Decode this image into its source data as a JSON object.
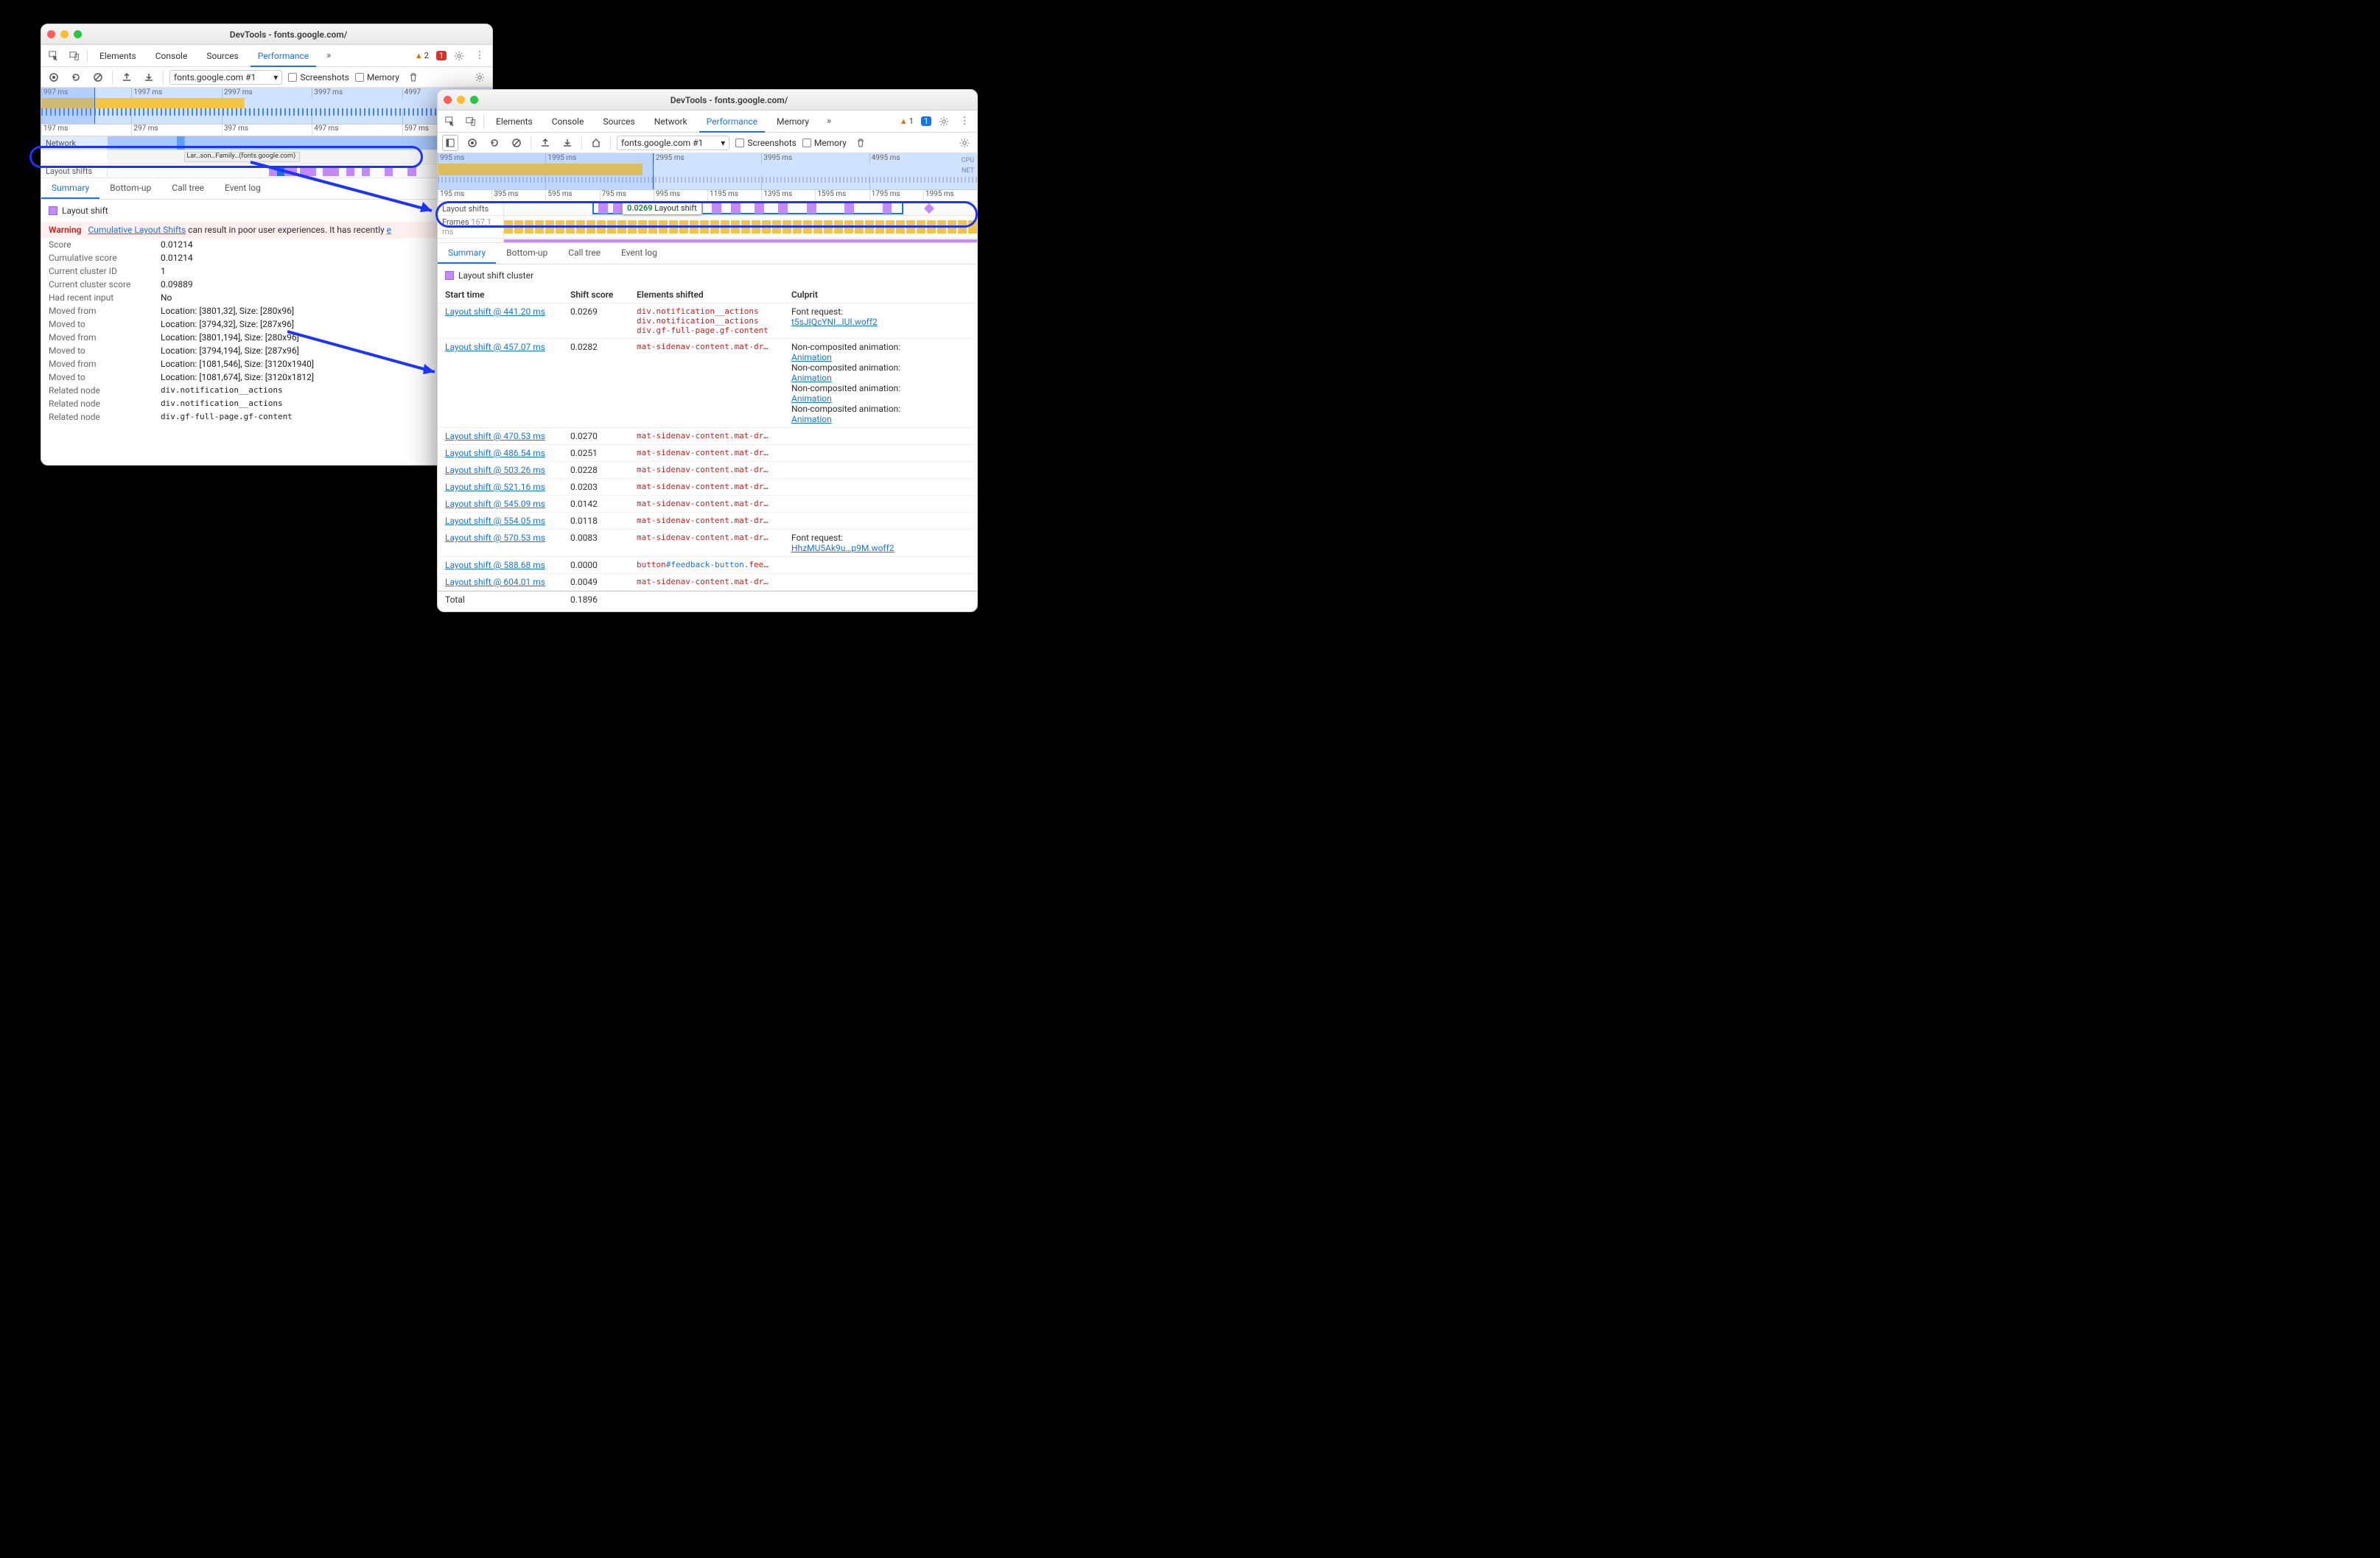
{
  "window_title": "DevTools - fonts.google.com/",
  "tabs": {
    "elements": "Elements",
    "console": "Console",
    "sources": "Sources",
    "network": "Network",
    "performance": "Performance",
    "memory_tab": "Memory"
  },
  "badges": {
    "warn_count": "2",
    "err_count": "1",
    "msg_count": "1"
  },
  "toolbar": {
    "url_selector": "fonts.google.com #1",
    "screenshots": "Screenshots",
    "memory": "Memory"
  },
  "left": {
    "tl_ticks": [
      "997 ms",
      "1997 ms",
      "2997 ms",
      "3997 ms",
      "4997"
    ],
    "ruler": [
      "197 ms",
      "297 ms",
      "397 ms",
      "497 ms",
      "597 ms"
    ],
    "network_row": "Network",
    "layout_shifts_row": "Layout shifts",
    "summary_tabs": {
      "summary": "Summary",
      "bottomup": "Bottom-up",
      "calltree": "Call tree",
      "eventlog": "Event log"
    },
    "heading": "Layout shift",
    "warning_label": "Warning",
    "warning_link": "Cumulative Layout Shifts",
    "warning_tail": " can result in poor user experiences. It has recently ",
    "kv": {
      "score_k": "Score",
      "score_v": "0.01214",
      "cumscore_k": "Cumulative score",
      "cumscore_v": "0.01214",
      "cid_k": "Current cluster ID",
      "cid_v": "1",
      "ccs_k": "Current cluster score",
      "ccs_v": "0.09889",
      "hri_k": "Had recent input",
      "hri_v": "No",
      "mf1_k": "Moved from",
      "mf1_v": "Location: [3801,32], Size: [280x96]",
      "mt1_k": "Moved to",
      "mt1_v": "Location: [3794,32], Size: [287x96]",
      "mf2_k": "Moved from",
      "mf2_v": "Location: [3801,194], Size: [280x96]",
      "mt2_k": "Moved to",
      "mt2_v": "Location: [3794,194], Size: [287x96]",
      "mf3_k": "Moved from",
      "mf3_v": "Location: [1081,546], Size: [3120x1940]",
      "mt3_k": "Moved to",
      "mt3_v": "Location: [1081,674], Size: [3120x1812]",
      "rn1_k": "Related node",
      "rn1_v": "div.notification__actions",
      "rn2_k": "Related node",
      "rn2_v": "div.notification__actions",
      "rn3_k": "Related node",
      "rn3_v": "div.gf-full-page.gf-content"
    }
  },
  "right": {
    "tl_ticks": [
      "995 ms",
      "1995 ms",
      "2995 ms",
      "3995 ms",
      "4995 ms"
    ],
    "ruler": [
      "195 ms",
      "395 ms",
      "595 ms",
      "795 ms",
      "995 ms",
      "1195 ms",
      "1395 ms",
      "1595 ms",
      "1795 ms",
      "1995 ms"
    ],
    "cpu": "CPU",
    "net": "NET",
    "layout_shifts_row": "Layout shifts",
    "frames_row": "Frames",
    "frames_val": "167.1 ms",
    "tooltip_val": "0.0269",
    "tooltip_label": "Layout shift",
    "heading": "Layout shift cluster",
    "tbl_head": {
      "c1": "Start time",
      "c2": "Shift score",
      "c3": "Elements shifted",
      "c4": "Culprit"
    },
    "rows": [
      {
        "t": "Layout shift @ 441.20 ms",
        "s": "0.0269",
        "e": "div.notification__actions\ndiv.notification__actions\ndiv.gf-full-page.gf-content",
        "c": "Font request:",
        "cl": "t5sJIQcYNI…IUI.woff2"
      },
      {
        "t": "Layout shift @ 457.07 ms",
        "s": "0.0282",
        "e": "mat-sidenav-content.mat-dr…",
        "c": "Non-composited animation:\nAnimation\nNon-composited animation:\nAnimation\nNon-composited animation:\nAnimation\nNon-composited animation:\nAnimation",
        "cl": ""
      },
      {
        "t": "Layout shift @ 470.53 ms",
        "s": "0.0270",
        "e": "mat-sidenav-content.mat-dr…",
        "c": "",
        "cl": ""
      },
      {
        "t": "Layout shift @ 486.54 ms",
        "s": "0.0251",
        "e": "mat-sidenav-content.mat-dr…",
        "c": "",
        "cl": ""
      },
      {
        "t": "Layout shift @ 503.26 ms",
        "s": "0.0228",
        "e": "mat-sidenav-content.mat-dr…",
        "c": "",
        "cl": ""
      },
      {
        "t": "Layout shift @ 521.16 ms",
        "s": "0.0203",
        "e": "mat-sidenav-content.mat-dr…",
        "c": "",
        "cl": ""
      },
      {
        "t": "Layout shift @ 545.09 ms",
        "s": "0.0142",
        "e": "mat-sidenav-content.mat-dr…",
        "c": "",
        "cl": ""
      },
      {
        "t": "Layout shift @ 554.05 ms",
        "s": "0.0118",
        "e": "mat-sidenav-content.mat-dr…",
        "c": "",
        "cl": ""
      },
      {
        "t": "Layout shift @ 570.53 ms",
        "s": "0.0083",
        "e": "mat-sidenav-content.mat-dr…",
        "c": "Font request:",
        "cl": "HhzMU5Ak9u…p9M.woff2"
      },
      {
        "t": "Layout shift @ 588.68 ms",
        "s": "0.0000",
        "e": "button#feedback-button.fee…",
        "c": "",
        "cl": ""
      },
      {
        "t": "Layout shift @ 604.01 ms",
        "s": "0.0049",
        "e": "mat-sidenav-content.mat-dr…",
        "c": "",
        "cl": ""
      }
    ],
    "total_k": "Total",
    "total_v": "0.1896"
  },
  "chart_data": {
    "type": "table",
    "title": "Layout shift cluster",
    "columns": [
      "Start time (ms)",
      "Shift score"
    ],
    "rows": [
      [
        441.2,
        0.0269
      ],
      [
        457.07,
        0.0282
      ],
      [
        470.53,
        0.027
      ],
      [
        486.54,
        0.0251
      ],
      [
        503.26,
        0.0228
      ],
      [
        521.16,
        0.0203
      ],
      [
        545.09,
        0.0142
      ],
      [
        554.05,
        0.0118
      ],
      [
        570.53,
        0.0083
      ],
      [
        588.68,
        0.0
      ],
      [
        604.01,
        0.0049
      ]
    ],
    "total_shift_score": 0.1896,
    "selected_detail": {
      "score": 0.01214,
      "cumulative_score": 0.01214,
      "current_cluster_id": 1,
      "current_cluster_score": 0.09889,
      "had_recent_input": false
    }
  }
}
